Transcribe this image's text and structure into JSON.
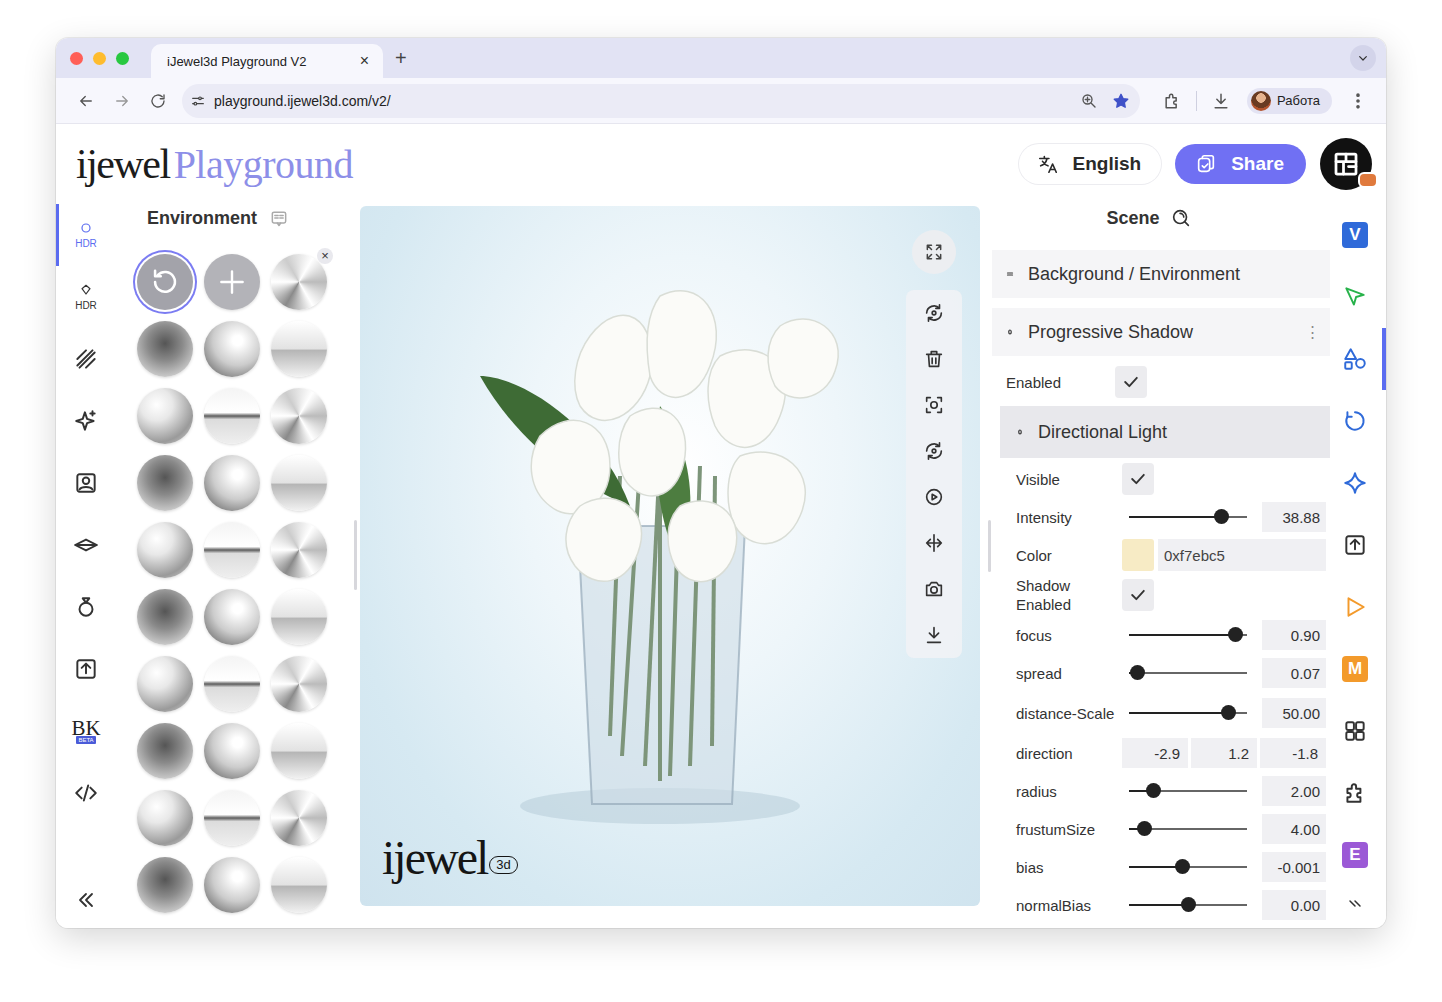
{
  "browser": {
    "tabs": [
      {
        "title": "iJewel3d Playground V2",
        "close": "×",
        "selected": true
      }
    ],
    "new_tab": "+",
    "url": "playground.ijewel3d.com/v2/",
    "bookmarked": true,
    "profile": "Работа"
  },
  "header": {
    "logo": {
      "brand": "ijewel",
      "product": "Playground"
    },
    "language": "English",
    "share": "Share"
  },
  "left_rail": {
    "items": [
      {
        "label": "HDR",
        "selected": true
      },
      {
        "label": "HDR",
        "selected": false
      },
      {
        "selected": false
      },
      {
        "selected": false
      },
      {
        "selected": false
      },
      {
        "selected": false
      },
      {
        "selected": false
      },
      {
        "selected": false
      },
      {
        "label": "BK",
        "badge": "BETA",
        "selected": false
      },
      {
        "selected": false
      }
    ]
  },
  "environment": {
    "title": "Environment",
    "items": [
      {
        "kind": "reset",
        "selected": true
      },
      {
        "kind": "add",
        "selected": false
      },
      {
        "kind": "map",
        "selected": false,
        "remove": "×"
      },
      {
        "kind": "map",
        "selected": false
      },
      {
        "kind": "map",
        "selected": false
      },
      {
        "kind": "map",
        "selected": false
      },
      {
        "kind": "map",
        "selected": false
      },
      {
        "kind": "map",
        "selected": false
      },
      {
        "kind": "map",
        "selected": false
      },
      {
        "kind": "map",
        "selected": false
      },
      {
        "kind": "map",
        "selected": false
      },
      {
        "kind": "map",
        "selected": false
      },
      {
        "kind": "map",
        "selected": false
      },
      {
        "kind": "map",
        "selected": false
      },
      {
        "kind": "map",
        "selected": false
      },
      {
        "kind": "map",
        "selected": false
      },
      {
        "kind": "map",
        "selected": false
      },
      {
        "kind": "map",
        "selected": false
      },
      {
        "kind": "map",
        "selected": false
      },
      {
        "kind": "map",
        "selected": false
      },
      {
        "kind": "map",
        "selected": false
      },
      {
        "kind": "map",
        "selected": false
      },
      {
        "kind": "map",
        "selected": false
      },
      {
        "kind": "map",
        "selected": false
      },
      {
        "kind": "map",
        "selected": false
      },
      {
        "kind": "map",
        "selected": false
      },
      {
        "kind": "map",
        "selected": false
      },
      {
        "kind": "map",
        "selected": false
      },
      {
        "kind": "map",
        "selected": false
      },
      {
        "kind": "map",
        "selected": false
      }
    ]
  },
  "viewport": {
    "watermark": {
      "brand": "ijewel",
      "badge": "3d"
    }
  },
  "scene": {
    "title": "Scene",
    "sections": [
      {
        "title": "Background / Environment",
        "expanded": false
      },
      {
        "title": "Progressive Shadow",
        "expanded": true,
        "menu": "⋮"
      }
    ],
    "shadow_props": [
      {
        "kind": "checkbox",
        "label": "Enabled",
        "checked": true
      }
    ],
    "directional_light": {
      "title": "Directional Light",
      "expanded": true,
      "props": [
        {
          "kind": "checkbox",
          "label": "Visible",
          "checked": true
        },
        {
          "kind": "slider",
          "label": "Intensity",
          "level": 0.78,
          "value": "38.88"
        },
        {
          "kind": "color",
          "label": "Color",
          "color": "#f7ebc5",
          "value": "0xf7ebc5"
        },
        {
          "kind": "checkbox",
          "label": "Shadow Enabled",
          "checked": true
        },
        {
          "kind": "slider",
          "label": "focus",
          "level": 0.9,
          "value": "0.90"
        },
        {
          "kind": "slider",
          "label": "spread",
          "level": 0.07,
          "value": "0.07"
        },
        {
          "kind": "slider",
          "label": "distance-Scale",
          "level": 0.84,
          "value": "50.00"
        },
        {
          "kind": "vector",
          "label": "direction",
          "values": [
            "-2.9",
            "1.2",
            "-1.8"
          ]
        },
        {
          "kind": "slider",
          "label": "radius",
          "level": 0.2,
          "value": "2.00"
        },
        {
          "kind": "slider",
          "label": "frustumSize",
          "level": 0.13,
          "value": "4.00"
        },
        {
          "kind": "slider",
          "label": "bias",
          "level": 0.45,
          "value": "-0.001"
        },
        {
          "kind": "slider",
          "label": "normalBias",
          "level": 0.5,
          "value": "0.00"
        }
      ]
    }
  },
  "right_rail": {
    "items": [
      {
        "label": "V",
        "color": "#2f6ad9",
        "selected": false
      },
      {
        "color": "#27b24a",
        "selected": false
      },
      {
        "color": "#2f6ad9",
        "selected": true
      },
      {
        "color": "#2f6ad9",
        "selected": false
      },
      {
        "color": "#2f6ad9",
        "selected": false
      },
      {
        "color": "#333333",
        "selected": false
      },
      {
        "color": "#f39a2b",
        "selected": false
      },
      {
        "label": "M",
        "color": "#f39a2b",
        "selected": false
      },
      {
        "color": "#333333",
        "selected": false
      },
      {
        "color": "#333333",
        "selected": false
      },
      {
        "label": "E",
        "color": "#9b59d6",
        "selected": false
      }
    ]
  }
}
